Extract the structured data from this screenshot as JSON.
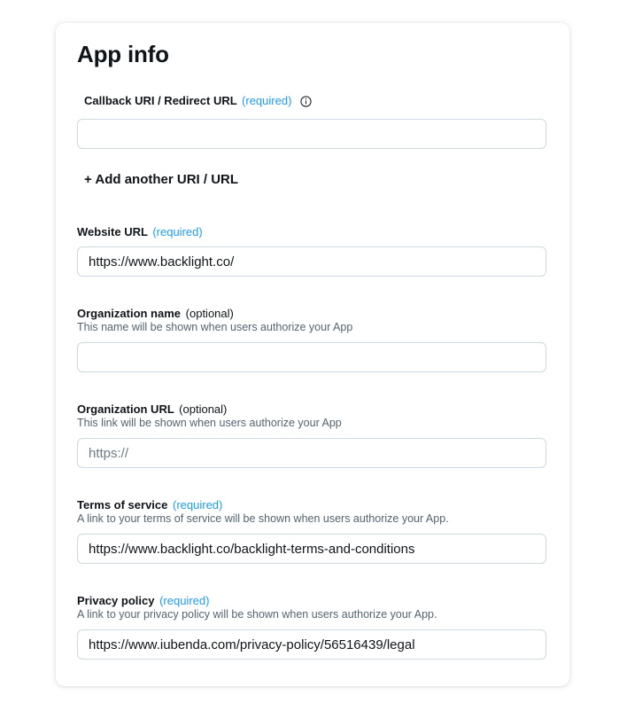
{
  "title": "App info",
  "callback": {
    "label": "Callback URI / Redirect URL",
    "tag": "(required)",
    "value": "",
    "icon": "info-icon"
  },
  "add_uri": {
    "label": "+ Add another URI / URL"
  },
  "website": {
    "label": "Website URL",
    "tag": "(required)",
    "value": "https://www.backlight.co/"
  },
  "org_name": {
    "label": "Organization name",
    "tag": "(optional)",
    "help": "This name will be shown when users authorize your App",
    "value": ""
  },
  "org_url": {
    "label": "Organization URL",
    "tag": "(optional)",
    "help": "This link will be shown when users authorize your App",
    "value": "",
    "placeholder": "https://"
  },
  "terms": {
    "label": "Terms of service",
    "tag": "(required)",
    "help": "A link to your terms of service will be shown when users authorize your App.",
    "value": "https://www.backlight.co/backlight-terms-and-conditions"
  },
  "privacy": {
    "label": "Privacy policy",
    "tag": "(required)",
    "help": "A link to your privacy policy will be shown when users authorize your App.",
    "value": "https://www.iubenda.com/privacy-policy/56516439/legal"
  },
  "colors": {
    "accent": "#1d9bf0",
    "text": "#0f1419",
    "muted": "#536471",
    "border": "#cfd9de"
  }
}
